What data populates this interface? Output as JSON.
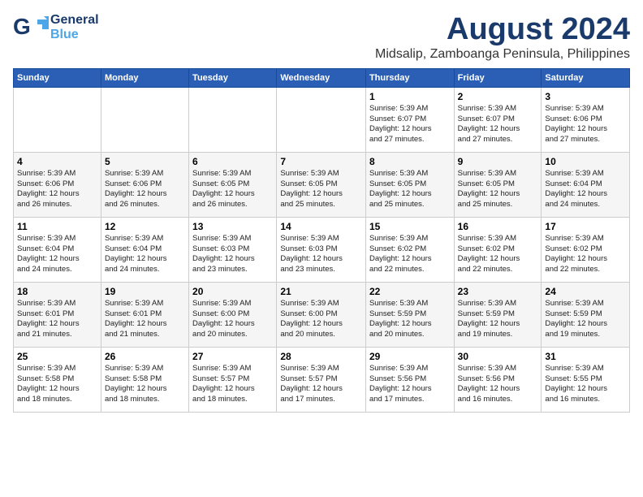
{
  "logo": {
    "line1": "General",
    "line2": "Blue"
  },
  "title": "August 2024",
  "location": "Midsalip, Zamboanga Peninsula, Philippines",
  "weekdays": [
    "Sunday",
    "Monday",
    "Tuesday",
    "Wednesday",
    "Thursday",
    "Friday",
    "Saturday"
  ],
  "weeks": [
    [
      {
        "day": "",
        "info": ""
      },
      {
        "day": "",
        "info": ""
      },
      {
        "day": "",
        "info": ""
      },
      {
        "day": "",
        "info": ""
      },
      {
        "day": "1",
        "info": "Sunrise: 5:39 AM\nSunset: 6:07 PM\nDaylight: 12 hours\nand 27 minutes."
      },
      {
        "day": "2",
        "info": "Sunrise: 5:39 AM\nSunset: 6:07 PM\nDaylight: 12 hours\nand 27 minutes."
      },
      {
        "day": "3",
        "info": "Sunrise: 5:39 AM\nSunset: 6:06 PM\nDaylight: 12 hours\nand 27 minutes."
      }
    ],
    [
      {
        "day": "4",
        "info": "Sunrise: 5:39 AM\nSunset: 6:06 PM\nDaylight: 12 hours\nand 26 minutes."
      },
      {
        "day": "5",
        "info": "Sunrise: 5:39 AM\nSunset: 6:06 PM\nDaylight: 12 hours\nand 26 minutes."
      },
      {
        "day": "6",
        "info": "Sunrise: 5:39 AM\nSunset: 6:05 PM\nDaylight: 12 hours\nand 26 minutes."
      },
      {
        "day": "7",
        "info": "Sunrise: 5:39 AM\nSunset: 6:05 PM\nDaylight: 12 hours\nand 25 minutes."
      },
      {
        "day": "8",
        "info": "Sunrise: 5:39 AM\nSunset: 6:05 PM\nDaylight: 12 hours\nand 25 minutes."
      },
      {
        "day": "9",
        "info": "Sunrise: 5:39 AM\nSunset: 6:05 PM\nDaylight: 12 hours\nand 25 minutes."
      },
      {
        "day": "10",
        "info": "Sunrise: 5:39 AM\nSunset: 6:04 PM\nDaylight: 12 hours\nand 24 minutes."
      }
    ],
    [
      {
        "day": "11",
        "info": "Sunrise: 5:39 AM\nSunset: 6:04 PM\nDaylight: 12 hours\nand 24 minutes."
      },
      {
        "day": "12",
        "info": "Sunrise: 5:39 AM\nSunset: 6:04 PM\nDaylight: 12 hours\nand 24 minutes."
      },
      {
        "day": "13",
        "info": "Sunrise: 5:39 AM\nSunset: 6:03 PM\nDaylight: 12 hours\nand 23 minutes."
      },
      {
        "day": "14",
        "info": "Sunrise: 5:39 AM\nSunset: 6:03 PM\nDaylight: 12 hours\nand 23 minutes."
      },
      {
        "day": "15",
        "info": "Sunrise: 5:39 AM\nSunset: 6:02 PM\nDaylight: 12 hours\nand 22 minutes."
      },
      {
        "day": "16",
        "info": "Sunrise: 5:39 AM\nSunset: 6:02 PM\nDaylight: 12 hours\nand 22 minutes."
      },
      {
        "day": "17",
        "info": "Sunrise: 5:39 AM\nSunset: 6:02 PM\nDaylight: 12 hours\nand 22 minutes."
      }
    ],
    [
      {
        "day": "18",
        "info": "Sunrise: 5:39 AM\nSunset: 6:01 PM\nDaylight: 12 hours\nand 21 minutes."
      },
      {
        "day": "19",
        "info": "Sunrise: 5:39 AM\nSunset: 6:01 PM\nDaylight: 12 hours\nand 21 minutes."
      },
      {
        "day": "20",
        "info": "Sunrise: 5:39 AM\nSunset: 6:00 PM\nDaylight: 12 hours\nand 20 minutes."
      },
      {
        "day": "21",
        "info": "Sunrise: 5:39 AM\nSunset: 6:00 PM\nDaylight: 12 hours\nand 20 minutes."
      },
      {
        "day": "22",
        "info": "Sunrise: 5:39 AM\nSunset: 5:59 PM\nDaylight: 12 hours\nand 20 minutes."
      },
      {
        "day": "23",
        "info": "Sunrise: 5:39 AM\nSunset: 5:59 PM\nDaylight: 12 hours\nand 19 minutes."
      },
      {
        "day": "24",
        "info": "Sunrise: 5:39 AM\nSunset: 5:59 PM\nDaylight: 12 hours\nand 19 minutes."
      }
    ],
    [
      {
        "day": "25",
        "info": "Sunrise: 5:39 AM\nSunset: 5:58 PM\nDaylight: 12 hours\nand 18 minutes."
      },
      {
        "day": "26",
        "info": "Sunrise: 5:39 AM\nSunset: 5:58 PM\nDaylight: 12 hours\nand 18 minutes."
      },
      {
        "day": "27",
        "info": "Sunrise: 5:39 AM\nSunset: 5:57 PM\nDaylight: 12 hours\nand 18 minutes."
      },
      {
        "day": "28",
        "info": "Sunrise: 5:39 AM\nSunset: 5:57 PM\nDaylight: 12 hours\nand 17 minutes."
      },
      {
        "day": "29",
        "info": "Sunrise: 5:39 AM\nSunset: 5:56 PM\nDaylight: 12 hours\nand 17 minutes."
      },
      {
        "day": "30",
        "info": "Sunrise: 5:39 AM\nSunset: 5:56 PM\nDaylight: 12 hours\nand 16 minutes."
      },
      {
        "day": "31",
        "info": "Sunrise: 5:39 AM\nSunset: 5:55 PM\nDaylight: 12 hours\nand 16 minutes."
      }
    ]
  ]
}
